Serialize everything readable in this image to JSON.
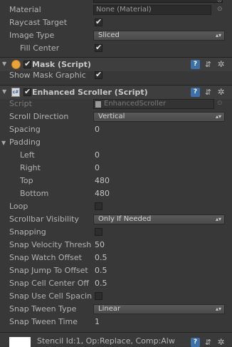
{
  "image_component": {
    "material_label": "Material",
    "material_value": "None (Material)",
    "raycast_label": "Raycast Target",
    "raycast_checked": true,
    "image_type_label": "Image Type",
    "image_type_value": "Sliced",
    "fill_center_label": "Fill Center",
    "fill_center_checked": true
  },
  "mask_component": {
    "title": "Mask (Script)",
    "enabled": true,
    "show_graphic_label": "Show Mask Graphic",
    "show_graphic_checked": true
  },
  "scroller_component": {
    "title": "Enhanced Scroller (Script)",
    "enabled": true,
    "icon_text": "c#",
    "script_label": "Script",
    "script_value": "EnhancedScroller",
    "scroll_direction_label": "Scroll Direction",
    "scroll_direction_value": "Vertical",
    "spacing_label": "Spacing",
    "spacing_value": "0",
    "padding_label": "Padding",
    "padding": {
      "left_label": "Left",
      "left_value": "0",
      "right_label": "Right",
      "right_value": "0",
      "top_label": "Top",
      "top_value": "480",
      "bottom_label": "Bottom",
      "bottom_value": "480"
    },
    "loop_label": "Loop",
    "loop_checked": false,
    "scrollbar_visibility_label": "Scrollbar Visibility",
    "scrollbar_visibility_value": "Only If Needed",
    "snapping_label": "Snapping",
    "snapping_checked": false,
    "snap_velocity_label": "Snap Velocity Thresh",
    "snap_velocity_value": "50",
    "snap_watch_label": "Snap Watch Offset",
    "snap_watch_value": "0.5",
    "snap_jump_label": "Snap Jump To Offset",
    "snap_jump_value": "0.5",
    "snap_cell_center_label": "Snap Cell Center Off",
    "snap_cell_center_value": "0.5",
    "snap_use_cell_label": "Snap Use Cell Spacin",
    "snap_use_cell_checked": false,
    "snap_tween_type_label": "Snap Tween Type",
    "snap_tween_type_value": "Linear",
    "snap_tween_time_label": "Snap Tween Time",
    "snap_tween_time_value": "1"
  },
  "bottom": {
    "stencil_text": "Stencil Id:1, Op:Replace, Comp:Alw"
  },
  "icons": {
    "help": "?",
    "preset": "⇵",
    "gear": "✲",
    "foldout_open": "▼",
    "dropdown_arrow": "▴▾"
  },
  "colors": {
    "panel_bg": "#383838",
    "header_bg": "#3e3e3e",
    "accent_help": "#3d6fa8",
    "mask_icon": "#e8a33a"
  }
}
